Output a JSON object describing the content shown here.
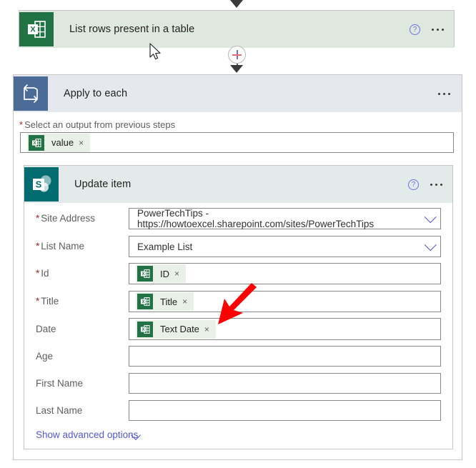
{
  "flow": {
    "steps": [
      {
        "id": "list-rows",
        "title": "List rows present in a table",
        "icon": "excel-icon",
        "help_label": "?",
        "menu_label": "..."
      },
      {
        "id": "apply-to-each",
        "title": "Apply to each",
        "icon": "loop-icon",
        "menu_label": "...",
        "output_section_label": "Select an output from previous steps",
        "output_required": "*",
        "output_token": {
          "label": "value",
          "icon": "excel-icon",
          "remove_label": "×"
        }
      },
      {
        "id": "update-item",
        "title": "Update item",
        "icon": "sharepoint-icon",
        "help_label": "?",
        "menu_label": "...",
        "advanced_options_label": "Show advanced options",
        "fields": [
          {
            "label": "Site Address",
            "required": true,
            "type": "dropdown",
            "value": "PowerTechTips - https://howtoexcel.sharepoint.com/sites/PowerTechTips"
          },
          {
            "label": "List Name",
            "required": true,
            "type": "dropdown",
            "value": "Example List"
          },
          {
            "label": "Id",
            "required": true,
            "type": "token",
            "token": {
              "label": "ID",
              "icon": "excel-icon",
              "remove_label": "×"
            }
          },
          {
            "label": "Title",
            "required": true,
            "type": "token",
            "token": {
              "label": "Title",
              "icon": "excel-icon",
              "remove_label": "×"
            }
          },
          {
            "label": "Date",
            "required": false,
            "type": "token",
            "token": {
              "label": "Text Date",
              "icon": "excel-icon",
              "remove_label": "×"
            }
          },
          {
            "label": "Age",
            "required": false,
            "type": "text",
            "value": ""
          },
          {
            "label": "First Name",
            "required": false,
            "type": "text",
            "value": ""
          },
          {
            "label": "Last Name",
            "required": false,
            "type": "text",
            "value": ""
          }
        ]
      }
    ],
    "insert_step_label": "+"
  },
  "annotation": {
    "type": "red-arrow",
    "points_to": "Date field token",
    "color": "#fe0000"
  },
  "colors": {
    "excel_green": "#217346",
    "excel_header": "#dfe8df",
    "loop_blue": "#4a6c96",
    "loop_header": "#e5e8ec",
    "sharepoint_teal": "#036c70",
    "sharepoint_header": "#e3eaea",
    "required_red": "#a4262c",
    "link_blue": "#5558d9",
    "token_chip": "#e8f0e8"
  }
}
